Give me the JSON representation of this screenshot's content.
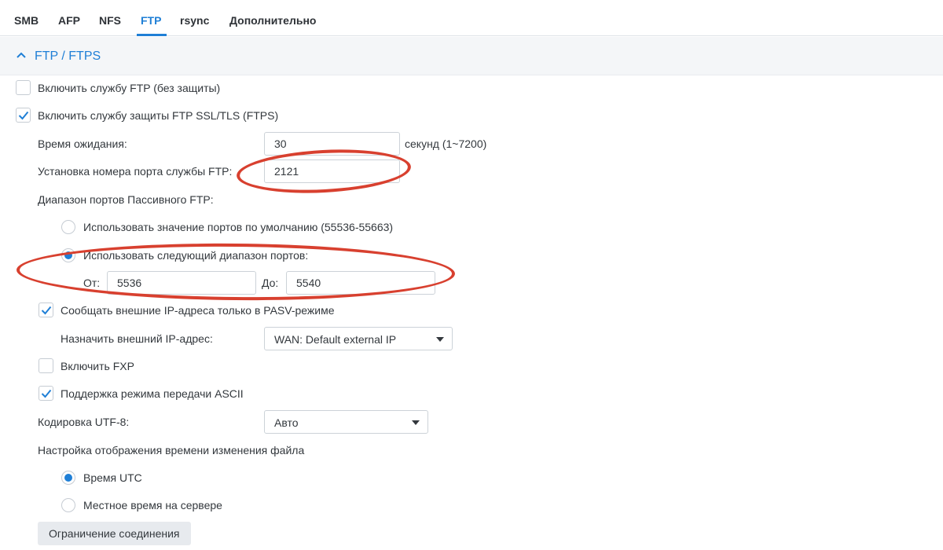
{
  "tabs": [
    {
      "label": "SMB"
    },
    {
      "label": "AFP"
    },
    {
      "label": "NFS"
    },
    {
      "label": "FTP",
      "active": true
    },
    {
      "label": "rsync"
    },
    {
      "label": "Дополнительно"
    }
  ],
  "section": {
    "title": "FTP / FTPS",
    "expanded": true
  },
  "ftp_plain": {
    "label": "Включить службу FTP (без защиты)",
    "checked": false
  },
  "ftps": {
    "label": "Включить службу защиты FTP SSL/TLS (FTPS)",
    "checked": true
  },
  "timeout": {
    "label": "Время ожидания:",
    "value": "30",
    "suffix": "секунд (1~7200)"
  },
  "port": {
    "label": "Установка номера порта службы FTP:",
    "value": "2121"
  },
  "passive": {
    "label": "Диапазон портов Пассивного FTP:",
    "default_option": {
      "label": "Использовать значение портов по умолчанию (55536-55663)",
      "selected": false
    },
    "custom_option": {
      "label": "Использовать следующий диапазон портов:",
      "selected": true
    },
    "from_label": "От:",
    "from_value": "5536",
    "to_label": "До:",
    "to_value": "5540"
  },
  "pasv_ip": {
    "label": "Сообщать внешние IP-адреса только в PASV-режиме",
    "checked": true
  },
  "external_ip": {
    "label": "Назначить внешний IP-адрес:",
    "value": "WAN: Default external IP"
  },
  "fxp": {
    "label": "Включить FXP",
    "checked": false
  },
  "ascii": {
    "label": "Поддержка режима передачи ASCII",
    "checked": true
  },
  "utf8": {
    "label": "Кодировка UTF-8:",
    "value": "Авто"
  },
  "file_time": {
    "label": "Настройка отображения времени изменения файла",
    "utc": {
      "label": "Время UTC",
      "selected": true
    },
    "local": {
      "label": "Местное время на сервере",
      "selected": false
    }
  },
  "limit_button": {
    "label": "Ограничение соединения"
  },
  "colors": {
    "accent": "#1f7fd6",
    "annotation": "#d8402f"
  }
}
